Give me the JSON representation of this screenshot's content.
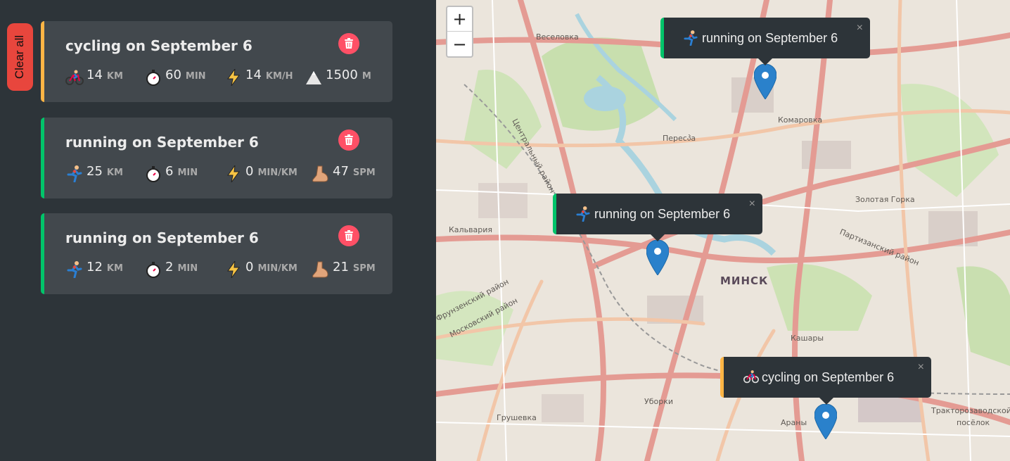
{
  "sidebar": {
    "clear_all_label": "Clear all",
    "workouts": [
      {
        "type": "cycling",
        "title": "cycling on September 6",
        "distance": "14",
        "distance_unit": "KM",
        "duration": "60",
        "duration_unit": "MIN",
        "speed": "14",
        "speed_unit": "KM/H",
        "elevation": "1500",
        "elevation_unit": "M"
      },
      {
        "type": "running",
        "title": "running on September 6",
        "distance": "25",
        "distance_unit": "KM",
        "duration": "6",
        "duration_unit": "MIN",
        "pace": "0",
        "pace_unit": "MIN/KM",
        "cadence": "47",
        "cadence_unit": "SPM"
      },
      {
        "type": "running",
        "title": "running on September 6",
        "distance": "12",
        "distance_unit": "KM",
        "duration": "2",
        "duration_unit": "MIN",
        "pace": "0",
        "pace_unit": "MIN/KM",
        "cadence": "21",
        "cadence_unit": "SPM"
      }
    ]
  },
  "map": {
    "zoom_in_label": "+",
    "zoom_out_label": "−",
    "popups": [
      {
        "type": "running",
        "text": "running on September 6",
        "close": "×"
      },
      {
        "type": "running",
        "text": "running on September 6",
        "close": "×"
      },
      {
        "type": "cycling",
        "text": "cycling on September 6",
        "close": "×"
      }
    ],
    "labels": {
      "veselovka": "Веселовка",
      "komarovka": "Комаровка",
      "perespa": "Пересპа",
      "central_district": "Центральный район",
      "kalvaria": "Кальвария",
      "minsk": "МИНСК",
      "zolotaya_gorka": "Золотая Горка",
      "partizansky": "Партизанский район",
      "frunzensky": "Фрунзенский район",
      "moskovsky": "Московский район",
      "kashary": "Кашары",
      "uborki": "Уборки",
      "grushevka": "Грушевка",
      "arany": "Араны",
      "traktorozavodskoy": "Тракторозаводской",
      "poselok": "посёлок"
    }
  },
  "colors": {
    "running": "#00c46a",
    "cycling": "#ffb545",
    "delete": "#ff5066",
    "clear_all": "#e8463d",
    "marker": "#2a81cb"
  }
}
